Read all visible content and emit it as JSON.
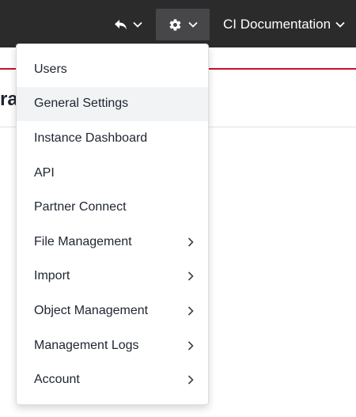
{
  "navbar": {
    "undo_icon": "undo-icon",
    "settings_icon": "gear-icon",
    "account_label": "CI Documentation",
    "chevron_icon": "chevron-down-icon",
    "bg_color": "#2b2b2c",
    "active_btn_color": "#474749",
    "accent_line_color": "#c8102e"
  },
  "page": {
    "title_fragment": "ra"
  },
  "menu": {
    "items": [
      {
        "label": "Users",
        "has_submenu": false,
        "active": false
      },
      {
        "label": "General Settings",
        "has_submenu": false,
        "active": true
      },
      {
        "label": "Instance Dashboard",
        "has_submenu": false,
        "active": false
      },
      {
        "label": "API",
        "has_submenu": false,
        "active": false
      },
      {
        "label": "Partner Connect",
        "has_submenu": false,
        "active": false
      },
      {
        "label": "File Management",
        "has_submenu": true,
        "active": false
      },
      {
        "label": "Import",
        "has_submenu": true,
        "active": false
      },
      {
        "label": "Object Management",
        "has_submenu": true,
        "active": false
      },
      {
        "label": "Management Logs",
        "has_submenu": true,
        "active": false
      },
      {
        "label": "Account",
        "has_submenu": true,
        "active": false
      }
    ],
    "submenu_icon": "chevron-right-icon"
  }
}
